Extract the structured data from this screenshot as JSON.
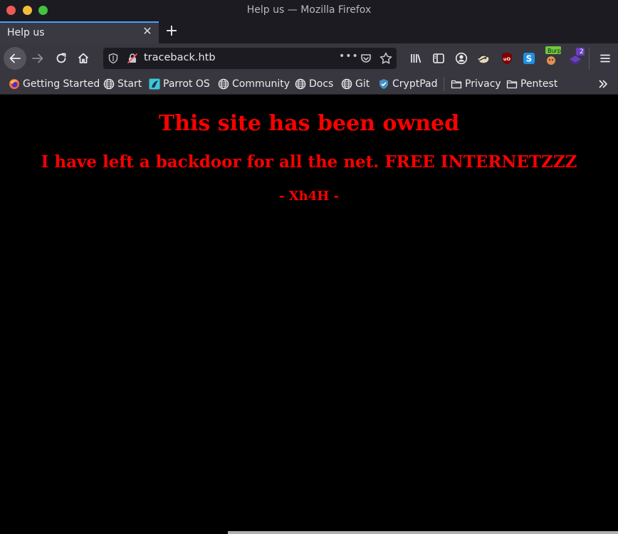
{
  "window": {
    "title": "Help us — Mozilla Firefox"
  },
  "tabs": [
    {
      "label": "Help us"
    }
  ],
  "nav": {
    "url": "traceback.htb",
    "page_actions": "•••"
  },
  "toolbar": {
    "burp_badge": "Burp",
    "foxy_badge": "2"
  },
  "bookmarks": {
    "items": [
      {
        "label": "Getting Started",
        "icon": "firefox-icon"
      },
      {
        "label": "Start",
        "icon": "globe-icon"
      },
      {
        "label": "Parrot OS",
        "icon": "parrot-icon"
      },
      {
        "label": "Community",
        "icon": "globe-icon"
      },
      {
        "label": "Docs",
        "icon": "globe-icon"
      },
      {
        "label": "Git",
        "icon": "globe-icon"
      },
      {
        "label": "CryptPad",
        "icon": "cryptpad-icon"
      },
      {
        "label": "Privacy",
        "icon": "folder-icon"
      },
      {
        "label": "Pentest",
        "icon": "folder-icon"
      }
    ]
  },
  "page": {
    "heading": "This site has been owned",
    "subheading": "I have left a backdoor for all the net. FREE INTERNETZZZ",
    "signature": "- Xh4H -",
    "text_color": "#ff0000",
    "background_color": "#000000"
  }
}
